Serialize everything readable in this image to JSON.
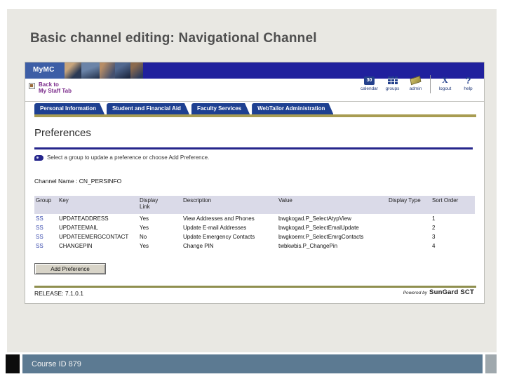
{
  "slide": {
    "title": "Basic channel editing: Navigational Channel",
    "footer": "Course ID 879"
  },
  "colors": {
    "banner_navy": "#20209d",
    "tab_blue": "#1e4091",
    "gold_bar": "#a89c52",
    "rule_blue": "#26268c",
    "rule_olive": "#8f8f4f",
    "footer_slate": "#5c7a92",
    "link_purple": "#7a2a8a",
    "table_header_bg": "#dadae8"
  },
  "portal": {
    "brand": "MyMC",
    "back_link": {
      "line1": "Back to",
      "line2": "My Staff Tab"
    },
    "header_icons": {
      "calendar": {
        "glyph": "30",
        "label": "calendar"
      },
      "groups": {
        "label": "groups"
      },
      "admin": {
        "label": "admin"
      },
      "logout": {
        "glyph": "X",
        "label": "logout"
      },
      "help": {
        "glyph": "?",
        "label": "help"
      }
    },
    "tabs": [
      "Personal Information",
      "Student and Financial Aid",
      "Faculty Services",
      "WebTailor Administration"
    ],
    "page": {
      "heading": "Preferences",
      "instruction": "Select a group to update a preference or choose Add Preference.",
      "channel_label": "Channel Name :",
      "channel_value": "CN_PERSINFO",
      "table": {
        "headers": [
          "Group",
          "Key",
          "Display Link",
          "Description",
          "Value",
          "Display Type",
          "Sort Order"
        ],
        "rows": [
          [
            "SS",
            "UPDATEADDRESS",
            "Yes",
            "View Addresses and Phones",
            "bwgkogad.P_SelectAtypView",
            "",
            "1"
          ],
          [
            "SS",
            "UPDATEEMAIL",
            "Yes",
            "Update E-mail Addresses",
            "bwgkogad.P_SelectEmalUpdate",
            "",
            "2"
          ],
          [
            "SS",
            "UPDATEEMERGCONTACT",
            "No",
            "Update Emergency Contacts",
            "bwgkoemr.P_SelectEmrgContacts",
            "",
            "3"
          ],
          [
            "SS",
            "CHANGEPIN",
            "Yes",
            "Change PIN",
            "twbkwbis.P_ChangePin",
            "",
            "4"
          ]
        ]
      },
      "add_button": "Add Preference",
      "release": "RELEASE: 7.1.0.1",
      "powered_prefix": "Powered by",
      "powered_brand": "SunGard SCT"
    }
  }
}
